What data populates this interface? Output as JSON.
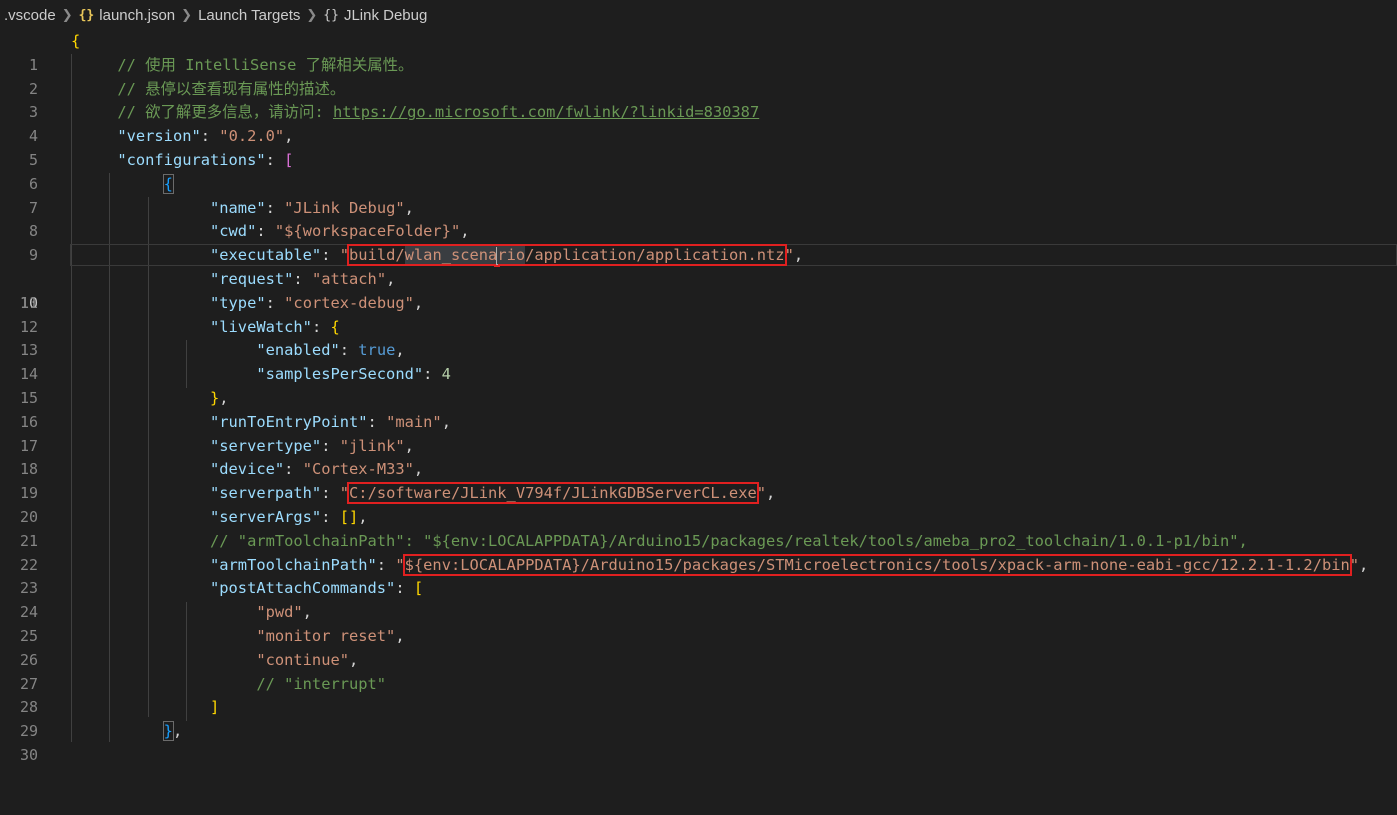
{
  "breadcrumb": {
    "folder": ".vscode",
    "file": "launch.json",
    "section": "Launch Targets",
    "item": "JLink Debug"
  },
  "editor": {
    "current_line": 10,
    "lines": [
      {
        "n": "1"
      },
      {
        "n": "2"
      },
      {
        "n": "3"
      },
      {
        "n": "4"
      },
      {
        "n": "5"
      },
      {
        "n": "6"
      },
      {
        "n": "7"
      },
      {
        "n": "8"
      },
      {
        "n": "9"
      },
      {
        "n": "10"
      },
      {
        "n": "11"
      },
      {
        "n": "12"
      },
      {
        "n": "13"
      },
      {
        "n": "14"
      },
      {
        "n": "15"
      },
      {
        "n": "16"
      },
      {
        "n": "17"
      },
      {
        "n": "18"
      },
      {
        "n": "19"
      },
      {
        "n": "20"
      },
      {
        "n": "21"
      },
      {
        "n": "22"
      },
      {
        "n": "23"
      },
      {
        "n": "24"
      },
      {
        "n": "25"
      },
      {
        "n": "26"
      },
      {
        "n": "27"
      },
      {
        "n": "28"
      },
      {
        "n": "29"
      },
      {
        "n": "30"
      }
    ],
    "code": {
      "c2": "// 使用 IntelliSense 了解相关属性。",
      "c3": "// 悬停以查看现有属性的描述。",
      "c4_prefix": "// 欲了解更多信息，请访问: ",
      "c4_link": "https://go.microsoft.com/fwlink/?linkid=830387",
      "k_version": "\"version\"",
      "v_version": "\"0.2.0\"",
      "k_configurations": "\"configurations\"",
      "k_name": "\"name\"",
      "v_name": "\"JLink Debug\"",
      "k_cwd": "\"cwd\"",
      "v_cwd": "\"${workspaceFolder}\"",
      "k_executable": "\"executable\"",
      "v_exec_a": "build/",
      "v_exec_sel1": "wlan_scena",
      "v_exec_sel2": "rio",
      "v_exec_b": "/application/application.ntz",
      "k_request": "\"request\"",
      "v_request": "\"attach\"",
      "k_type": "\"type\"",
      "v_type": "\"cortex-debug\"",
      "k_livewatch": "\"liveWatch\"",
      "k_enabled": "\"enabled\"",
      "v_enabled": "true",
      "k_samples": "\"samplesPerSecond\"",
      "v_samples": "4",
      "k_runto": "\"runToEntryPoint\"",
      "v_runto": "\"main\"",
      "k_servertype": "\"servertype\"",
      "v_servertype": "\"jlink\"",
      "k_device": "\"device\"",
      "v_device": "\"Cortex-M33\"",
      "k_serverpath": "\"serverpath\"",
      "v_serverpath": "C:/software/JLink_V794f/JLinkGDBServerCL.exe",
      "k_serverargs": "\"serverArgs\"",
      "c22": "// \"armToolchainPath\": \"${env:LOCALAPPDATA}/Arduino15/packages/realtek/tools/ameba_pro2_toolchain/1.0.1-p1/bin\",",
      "k_armtool": "\"armToolchainPath\"",
      "v_armtool": "${env:LOCALAPPDATA}/Arduino15/packages/STMicroelectronics/tools/xpack-arm-none-eabi-gcc/12.2.1-1.2/bin",
      "k_postattach": "\"postAttachCommands\"",
      "v_pwd": "\"pwd\"",
      "v_monitor": "\"monitor reset\"",
      "v_continue": "\"continue\"",
      "c28": "// \"interrupt\""
    }
  }
}
